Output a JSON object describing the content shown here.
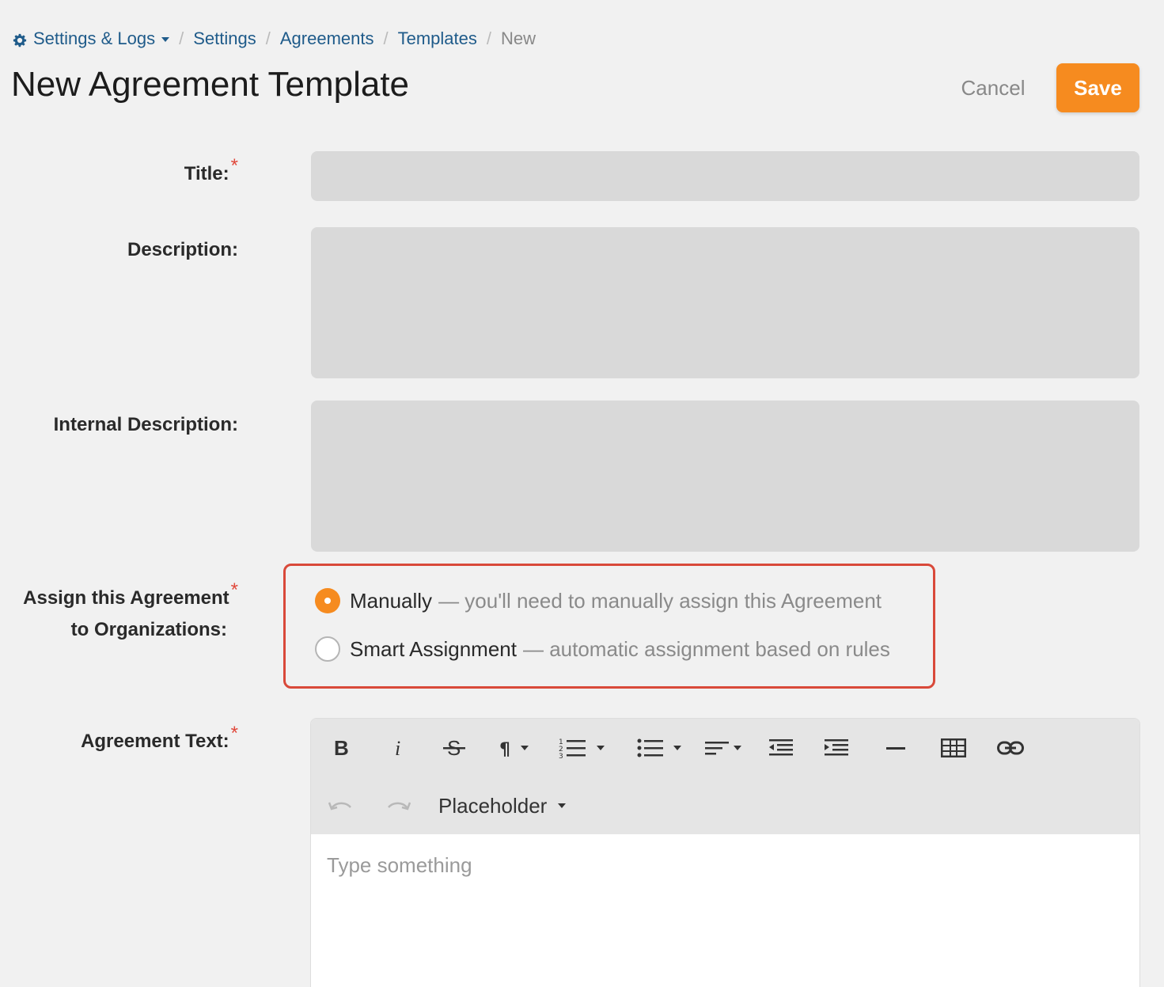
{
  "breadcrumb": {
    "root": "Settings & Logs",
    "items": [
      "Settings",
      "Agreements",
      "Templates"
    ],
    "current": "New",
    "separator": "/"
  },
  "page": {
    "title": "New Agreement Template"
  },
  "actions": {
    "cancel_label": "Cancel",
    "save_label": "Save"
  },
  "form": {
    "title_label": "Title:",
    "description_label": "Description:",
    "internal_description_label": "Internal Description:",
    "assign_label_line1": "Assign this Agreement",
    "assign_label_line2": "to Organizations:",
    "agreement_text_label": "Agreement Text:",
    "required_mark": "*",
    "title_value": "",
    "description_value": "",
    "internal_description_value": ""
  },
  "assignment": {
    "options": [
      {
        "label": "Manually",
        "description": "— you'll need to manually assign this Agreement",
        "selected": true
      },
      {
        "label": "Smart Assignment",
        "description": "— automatic assignment based on rules",
        "selected": false
      }
    ]
  },
  "editor": {
    "toolbar_icons": [
      "bold-icon",
      "italic-icon",
      "strikethrough-icon",
      "paragraph-icon",
      "ordered-list-icon",
      "unordered-list-icon",
      "align-icon",
      "outdent-icon",
      "indent-icon",
      "horizontal-rule-icon",
      "table-icon",
      "link-icon",
      "undo-icon",
      "redo-icon"
    ],
    "placeholder_menu_label": "Placeholder",
    "body_placeholder": "Type something"
  },
  "colors": {
    "accent": "#f68b1f",
    "link": "#1f5b8a",
    "highlight_border": "#d9493a",
    "required": "#e0483b",
    "background": "#f1f1f1",
    "field_bg": "#d9d9d9"
  }
}
